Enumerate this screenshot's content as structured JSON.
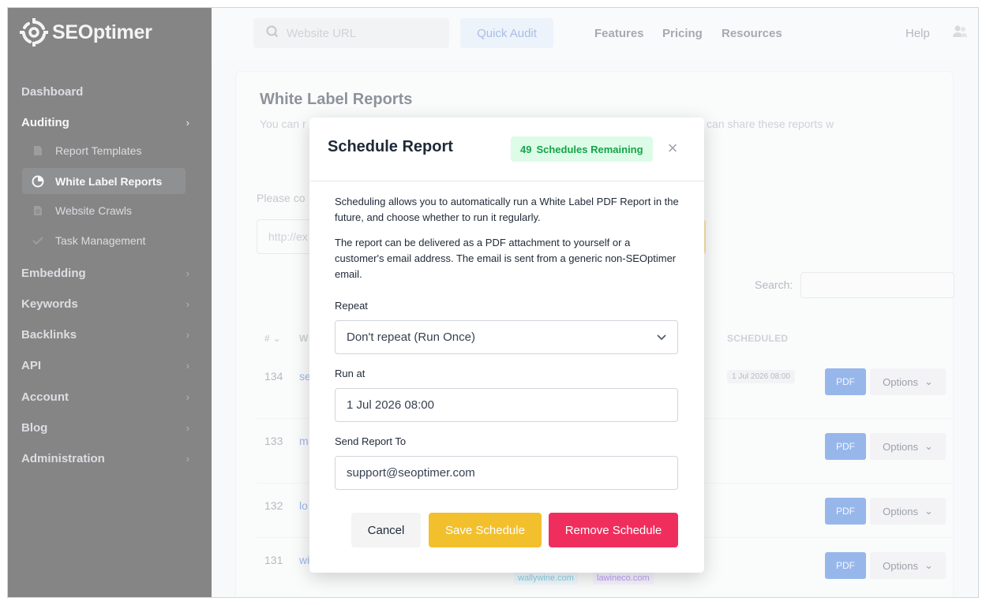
{
  "brand": {
    "name": "SEOptimer"
  },
  "sidebar": {
    "items": [
      {
        "label": "Dashboard"
      },
      {
        "label": "Auditing"
      },
      {
        "label": "Embedding"
      },
      {
        "label": "Keywords"
      },
      {
        "label": "Backlinks"
      },
      {
        "label": "API"
      },
      {
        "label": "Account"
      },
      {
        "label": "Blog"
      },
      {
        "label": "Administration"
      }
    ],
    "subitems": [
      {
        "label": "Report Templates",
        "icon": "document-icon"
      },
      {
        "label": "White Label Reports",
        "icon": "pie-chart-icon"
      },
      {
        "label": "Website Crawls",
        "icon": "crawl-icon"
      },
      {
        "label": "Task Management",
        "icon": "check-icon"
      }
    ]
  },
  "topbar": {
    "search_placeholder": "Website URL",
    "quick_audit": "Quick Audit",
    "links": [
      "Features",
      "Pricing",
      "Resources"
    ],
    "help": "Help"
  },
  "page": {
    "title": "White Label Reports",
    "description": "You can r                                                                                                                    e option to view the Report in PDF form or as a basic w                                                                                                                  fined in the next tab. You can share these reports w",
    "please": "Please co",
    "url_placeholder": "http://ex",
    "search_label": "Search:",
    "columns": {
      "num": "#",
      "w": "W",
      "scheduled": "SCHEDULED"
    },
    "rows": [
      {
        "num": "134",
        "link": "se",
        "scheduled": "1 Jul 2026 08:00"
      },
      {
        "num": "133",
        "link": "m"
      },
      {
        "num": "132",
        "link": "lo"
      },
      {
        "num": "131",
        "link": "wi"
      }
    ],
    "pdf_label": "PDF",
    "options_label": "Options",
    "tags": [
      "wallywine.com",
      "lawineco.com"
    ]
  },
  "modal": {
    "title": "Schedule Report",
    "remaining_count": "49",
    "remaining_label": "Schedules Remaining",
    "para1": "Scheduling allows you to automatically run a White Label PDF Report in the future, and choose whether to run it regularly.",
    "para2": "The report can be delivered as a PDF attachment to yourself or a customer's email address. The email is sent from a generic non-SEOptimer email.",
    "repeat_label": "Repeat",
    "repeat_value": "Don't repeat (Run Once)",
    "run_at_label": "Run at",
    "run_at_value": "1 Jul 2026 08:00",
    "send_to_label": "Send Report To",
    "send_to_value": "support@seoptimer.com",
    "cancel": "Cancel",
    "save": "Save Schedule",
    "remove": "Remove Schedule"
  },
  "colors": {
    "sidebar_bg": "#0b0b0d",
    "accent_blue": "#2f6fd6",
    "save_yellow": "#f2c02d",
    "remove_pink": "#f02e5e",
    "remaining_green": "#16a34a"
  }
}
